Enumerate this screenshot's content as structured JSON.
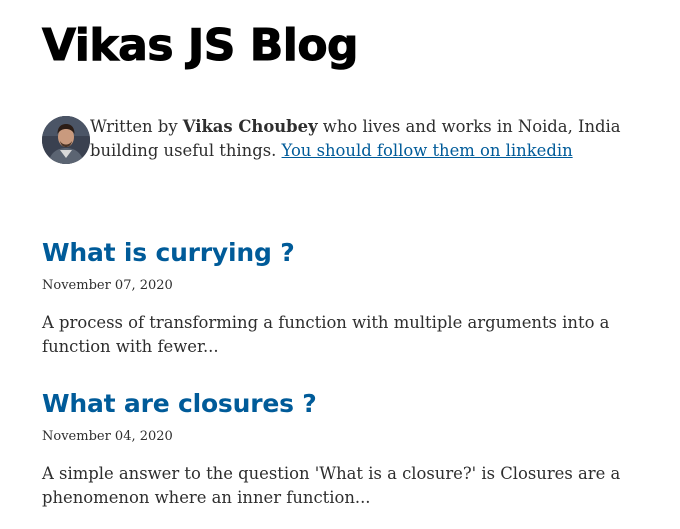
{
  "site": {
    "title": "Vikas JS Blog"
  },
  "bio": {
    "prefix": "Written by ",
    "author": "Vikas Choubey",
    "suffix": " who lives and works in Noida, India building useful things. ",
    "link_text": "You should follow them on linkedin"
  },
  "posts": [
    {
      "title": "What is currying ?",
      "date": "November 07, 2020",
      "excerpt": "A process of transforming a function with multiple arguments into a function with fewer..."
    },
    {
      "title": "What are closures ?",
      "date": "November 04, 2020",
      "excerpt": "A simple answer to the question 'What is a closure?' is Closures are a phenomenon where an inner function..."
    }
  ],
  "colors": {
    "link": "#005b99",
    "text": "#2e2e2e",
    "title": "#000000"
  },
  "icons": {
    "avatar": "author-photo"
  }
}
